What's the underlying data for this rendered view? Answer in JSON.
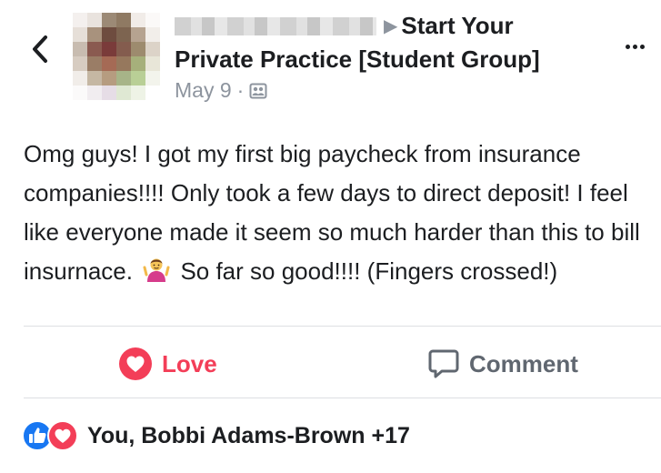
{
  "post": {
    "author_redacted": true,
    "group_name": "Start Your Private Practice [Student Group]",
    "date": "May 9",
    "audience_icon": "group-audience-icon",
    "body_part1": "Omg guys! I got my first big paycheck from insurance companies!!!! Only took a few days to direct deposit! I feel like everyone made it seem so much harder than this to bill insurnace.",
    "body_part2": "So far so good!!!! (Fingers crossed!)"
  },
  "actions": {
    "love_label": "Love",
    "comment_label": "Comment"
  },
  "reactions": {
    "summary": "You, Bobbi Adams-Brown +17",
    "icons": [
      "like-icon",
      "love-icon"
    ]
  },
  "colors": {
    "love": "#f33e58",
    "like": "#1877f2",
    "secondary_text": "#8d949e",
    "divider": "#dddfe2"
  }
}
